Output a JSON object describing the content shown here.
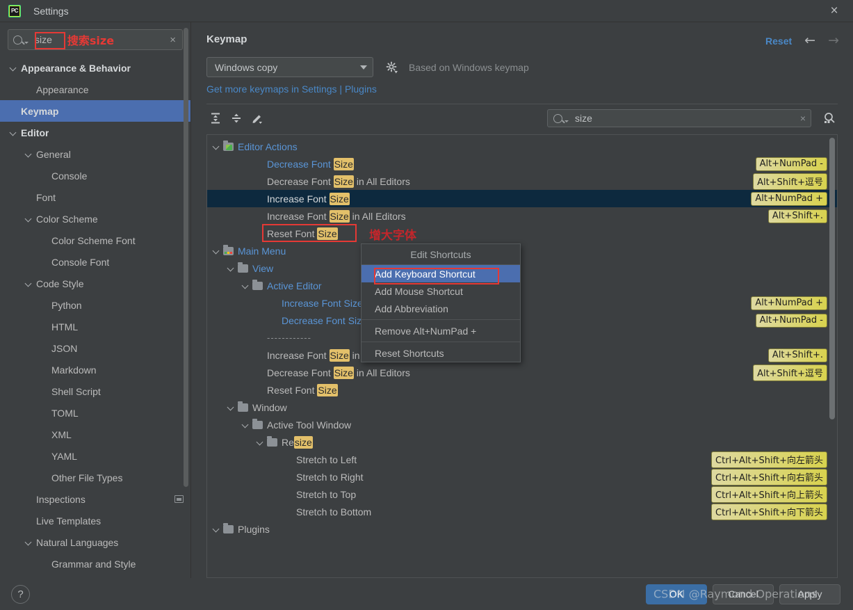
{
  "window": {
    "title": "Settings",
    "logo_text": "PC",
    "close_icon": "×"
  },
  "sidebar": {
    "search": {
      "value": "size",
      "annotation_cn": "搜索size",
      "clear_icon": "×"
    },
    "items": [
      {
        "label": "Appearance & Behavior",
        "indent": 0,
        "chevron": true,
        "bold": true,
        "selected": false
      },
      {
        "label": "Appearance",
        "indent": 1,
        "chevron": false,
        "bold": false,
        "selected": false
      },
      {
        "label": "Keymap",
        "indent": 0,
        "chevron": false,
        "bold": true,
        "selected": true
      },
      {
        "label": "Editor",
        "indent": 0,
        "chevron": true,
        "bold": true,
        "selected": false
      },
      {
        "label": "General",
        "indent": 1,
        "chevron": true,
        "bold": false,
        "selected": false
      },
      {
        "label": "Console",
        "indent": 2,
        "chevron": false,
        "bold": false,
        "selected": false
      },
      {
        "label": "Font",
        "indent": 1,
        "chevron": false,
        "bold": false,
        "selected": false
      },
      {
        "label": "Color Scheme",
        "indent": 1,
        "chevron": true,
        "bold": false,
        "selected": false
      },
      {
        "label": "Color Scheme Font",
        "indent": 2,
        "chevron": false,
        "bold": false,
        "selected": false
      },
      {
        "label": "Console Font",
        "indent": 2,
        "chevron": false,
        "bold": false,
        "selected": false
      },
      {
        "label": "Code Style",
        "indent": 1,
        "chevron": true,
        "bold": false,
        "selected": false
      },
      {
        "label": "Python",
        "indent": 2,
        "chevron": false,
        "bold": false,
        "selected": false
      },
      {
        "label": "HTML",
        "indent": 2,
        "chevron": false,
        "bold": false,
        "selected": false
      },
      {
        "label": "JSON",
        "indent": 2,
        "chevron": false,
        "bold": false,
        "selected": false
      },
      {
        "label": "Markdown",
        "indent": 2,
        "chevron": false,
        "bold": false,
        "selected": false
      },
      {
        "label": "Shell Script",
        "indent": 2,
        "chevron": false,
        "bold": false,
        "selected": false
      },
      {
        "label": "TOML",
        "indent": 2,
        "chevron": false,
        "bold": false,
        "selected": false
      },
      {
        "label": "XML",
        "indent": 2,
        "chevron": false,
        "bold": false,
        "selected": false
      },
      {
        "label": "YAML",
        "indent": 2,
        "chevron": false,
        "bold": false,
        "selected": false
      },
      {
        "label": "Other File Types",
        "indent": 2,
        "chevron": false,
        "bold": false,
        "selected": false
      },
      {
        "label": "Inspections",
        "indent": 1,
        "chevron": false,
        "bold": false,
        "selected": false,
        "badge": true
      },
      {
        "label": "Live Templates",
        "indent": 1,
        "chevron": false,
        "bold": false,
        "selected": false
      },
      {
        "label": "Natural Languages",
        "indent": 1,
        "chevron": true,
        "bold": false,
        "selected": false
      },
      {
        "label": "Grammar and Style",
        "indent": 2,
        "chevron": false,
        "bold": false,
        "selected": false
      }
    ]
  },
  "main": {
    "title": "Keymap",
    "reset_label": "Reset",
    "back_icon": "←",
    "forward_icon": "→",
    "keymap_select": {
      "value": "Windows copy"
    },
    "based_on": "Based on Windows keymap",
    "plugins_link": "Get more keymaps in Settings | Plugins",
    "toolbar": {
      "expand_all": "expand-all-icon",
      "collapse_all": "collapse-all-icon",
      "edit": "edit-pencil-icon"
    },
    "find": {
      "value": "size",
      "clear_icon": "×"
    },
    "annotation_cn": "增大字体"
  },
  "keymap_tree": [
    {
      "id": "editor-actions",
      "text_parts": [
        {
          "t": "Editor Actions",
          "hl": false
        }
      ],
      "indent": 0,
      "chevron": true,
      "folder": "edit",
      "link": true,
      "shortcut": ""
    },
    {
      "id": "decrease-font-size",
      "text_parts": [
        {
          "t": "Decrease Font ",
          "hl": false
        },
        {
          "t": "Size",
          "hl": true
        }
      ],
      "indent": 3,
      "chevron": false,
      "folder": null,
      "link": true,
      "shortcut": "Alt+NumPad -"
    },
    {
      "id": "decrease-font-size-all-editors",
      "text_parts": [
        {
          "t": "Decrease Font ",
          "hl": false
        },
        {
          "t": "Size",
          "hl": true
        },
        {
          "t": " in All Editors",
          "hl": false
        }
      ],
      "indent": 3,
      "chevron": false,
      "folder": null,
      "link": false,
      "shortcut": "Alt+Shift+逗号"
    },
    {
      "id": "increase-font-size",
      "text_parts": [
        {
          "t": "Increase Font ",
          "hl": false
        },
        {
          "t": "Size",
          "hl": true
        }
      ],
      "indent": 3,
      "chevron": false,
      "folder": null,
      "link": false,
      "selected": true,
      "shortcut": "Alt+NumPad +"
    },
    {
      "id": "increase-font-size-all-editors",
      "text_parts": [
        {
          "t": "Increase Font ",
          "hl": false
        },
        {
          "t": "Size",
          "hl": true
        },
        {
          "t": " in All Editors",
          "hl": false
        }
      ],
      "indent": 3,
      "chevron": false,
      "folder": null,
      "link": false,
      "shortcut": "Alt+Shift+."
    },
    {
      "id": "reset-font-size",
      "text_parts": [
        {
          "t": "Reset Font ",
          "hl": false
        },
        {
          "t": "Size",
          "hl": true
        }
      ],
      "indent": 3,
      "chevron": false,
      "folder": null,
      "link": false,
      "shortcut": ""
    },
    {
      "id": "main-menu",
      "text_parts": [
        {
          "t": "Main Menu",
          "hl": false
        }
      ],
      "indent": 0,
      "chevron": true,
      "folder": "dots",
      "link": true,
      "shortcut": ""
    },
    {
      "id": "view",
      "text_parts": [
        {
          "t": "View",
          "hl": false
        }
      ],
      "indent": 1,
      "chevron": true,
      "folder": "plain",
      "link": true,
      "shortcut": ""
    },
    {
      "id": "active-editor",
      "text_parts": [
        {
          "t": "Active Editor",
          "hl": false
        }
      ],
      "indent": 2,
      "chevron": true,
      "folder": "plain",
      "link": true,
      "shortcut": ""
    },
    {
      "id": "menu-increase-font-size",
      "text_parts": [
        {
          "t": "Increase Font Size",
          "hl": false
        }
      ],
      "indent": 4,
      "chevron": false,
      "folder": null,
      "link": true,
      "shortcut": "Alt+NumPad +"
    },
    {
      "id": "menu-decrease-font-size",
      "text_parts": [
        {
          "t": "Decrease Font Size",
          "hl": false
        }
      ],
      "indent": 4,
      "chevron": false,
      "folder": null,
      "link": true,
      "shortcut": "Alt+NumPad -"
    },
    {
      "id": "separator",
      "text_parts": [
        {
          "t": "------------",
          "hl": false
        }
      ],
      "indent": 3,
      "chevron": false,
      "folder": null,
      "link": false,
      "dashes": true,
      "shortcut": ""
    },
    {
      "id": "menu-increase-font-size-all",
      "text_parts": [
        {
          "t": "Increase Font ",
          "hl": false
        },
        {
          "t": "Size",
          "hl": true
        },
        {
          "t": " in All Editors",
          "hl": false
        }
      ],
      "indent": 3,
      "chevron": false,
      "folder": null,
      "link": false,
      "shortcut": "Alt+Shift+."
    },
    {
      "id": "menu-decrease-font-size-all",
      "text_parts": [
        {
          "t": "Decrease Font ",
          "hl": false
        },
        {
          "t": "Size",
          "hl": true
        },
        {
          "t": " in All Editors",
          "hl": false
        }
      ],
      "indent": 3,
      "chevron": false,
      "folder": null,
      "link": false,
      "shortcut": "Alt+Shift+逗号"
    },
    {
      "id": "menu-reset-font-size",
      "text_parts": [
        {
          "t": "Reset Font ",
          "hl": false
        },
        {
          "t": "Size",
          "hl": true
        }
      ],
      "indent": 3,
      "chevron": false,
      "folder": null,
      "link": false,
      "shortcut": ""
    },
    {
      "id": "window",
      "text_parts": [
        {
          "t": "Window",
          "hl": false
        }
      ],
      "indent": 1,
      "chevron": true,
      "folder": "plain",
      "link": false,
      "shortcut": ""
    },
    {
      "id": "active-tool-window",
      "text_parts": [
        {
          "t": "Active Tool Window",
          "hl": false
        }
      ],
      "indent": 2,
      "chevron": true,
      "folder": "plain",
      "link": false,
      "shortcut": ""
    },
    {
      "id": "resize",
      "text_parts": [
        {
          "t": "Re",
          "hl": false
        },
        {
          "t": "size",
          "hl": true
        }
      ],
      "indent": 3,
      "chevron": true,
      "folder": "plain",
      "link": false,
      "shortcut": ""
    },
    {
      "id": "stretch-to-left",
      "text_parts": [
        {
          "t": "Stretch to Left",
          "hl": false
        }
      ],
      "indent": 5,
      "chevron": false,
      "folder": null,
      "link": false,
      "shortcut": "Ctrl+Alt+Shift+向左箭头"
    },
    {
      "id": "stretch-to-right",
      "text_parts": [
        {
          "t": "Stretch to Right",
          "hl": false
        }
      ],
      "indent": 5,
      "chevron": false,
      "folder": null,
      "link": false,
      "shortcut": "Ctrl+Alt+Shift+向右箭头"
    },
    {
      "id": "stretch-to-top",
      "text_parts": [
        {
          "t": "Stretch to Top",
          "hl": false
        }
      ],
      "indent": 5,
      "chevron": false,
      "folder": null,
      "link": false,
      "shortcut": "Ctrl+Alt+Shift+向上箭头"
    },
    {
      "id": "stretch-to-bottom",
      "text_parts": [
        {
          "t": "Stretch to Bottom",
          "hl": false
        }
      ],
      "indent": 5,
      "chevron": false,
      "folder": null,
      "link": false,
      "shortcut": "Ctrl+Alt+Shift+向下箭头"
    },
    {
      "id": "plugins",
      "text_parts": [
        {
          "t": "Plugins",
          "hl": false
        }
      ],
      "indent": 0,
      "chevron": true,
      "folder": "plain",
      "link": false,
      "shortcut": ""
    }
  ],
  "context_menu": {
    "title": "Edit Shortcuts",
    "items": [
      {
        "label": "Add Keyboard Shortcut",
        "active": true,
        "sep_after": false
      },
      {
        "label": "Add Mouse Shortcut",
        "active": false,
        "sep_after": false
      },
      {
        "label": "Add Abbreviation",
        "active": false,
        "sep_after": true
      },
      {
        "label": "Remove Alt+NumPad +",
        "active": false,
        "sep_after": true
      },
      {
        "label": "Reset Shortcuts",
        "active": false,
        "sep_after": false
      }
    ]
  },
  "footer": {
    "help_label": "?",
    "ok_label": "OK",
    "cancel_label": "Cancel",
    "apply_label": "Apply",
    "watermark": "CSDN @Raymond Operations"
  },
  "colors": {
    "accent_blue": "#4b6eaf",
    "link_blue": "#4a88c7",
    "highlight_yellow": "#e3c06a",
    "annotation_red": "#e53935",
    "selected_row": "#0d293e",
    "panel_bg": "#3c3f41"
  }
}
